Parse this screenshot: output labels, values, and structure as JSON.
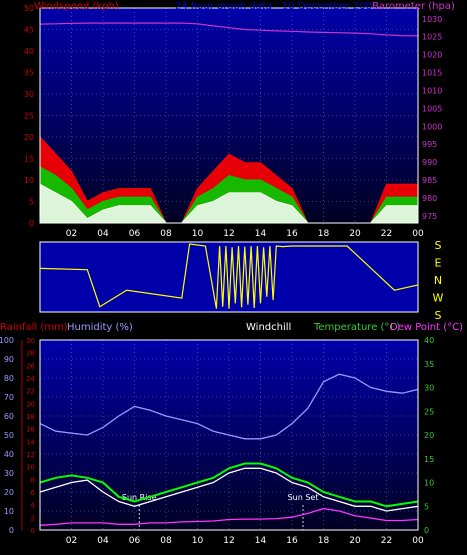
{
  "header": {
    "left_label": "Windspeed (kph)",
    "center_label": "24 hour graph data - 10 December 2008",
    "right_label": "Barometer (hpa)"
  },
  "colors": {
    "background": "#000000",
    "plot_top": "#0000aa",
    "plot_bottom": "#000022",
    "grid": "#6b6bd6",
    "wind_gust": "#ff0000",
    "wind_avg": "#00cc00",
    "wind_speed": "#ffffff",
    "barometer": "#cc33cc",
    "direction_plot": "#0000aa",
    "direction_line": "#ffff00",
    "rain_label": "#cc0000",
    "humidity": "#9999ff",
    "windchill_label": "#ffffff",
    "temperature": "#00ff00",
    "dewpoint": "#ff33ff",
    "wind_axis": "#cc0000",
    "baro_axis": "#cc33cc",
    "temp_axis": "#33cc33",
    "sun_marker": "#ffffff"
  },
  "chart_data": [
    {
      "type": "line",
      "xlabel": "",
      "x_ticks": [
        "02",
        "04",
        "06",
        "08",
        "10",
        "12",
        "14",
        "16",
        "18",
        "20",
        "22",
        "00"
      ],
      "left_axis": {
        "label": "Windspeed (kph)",
        "ticks": [
          0,
          5,
          10,
          15,
          20,
          25,
          30,
          35,
          40,
          45,
          50
        ],
        "ylim": [
          0,
          50
        ]
      },
      "right_axis": {
        "label": "Barometer (hpa)",
        "ticks": [
          975,
          980,
          985,
          990,
          995,
          1000,
          1005,
          1010,
          1015,
          1020,
          1025,
          1030
        ],
        "ylim": [
          973,
          1033
        ]
      },
      "hours": [
        0,
        1,
        2,
        3,
        4,
        5,
        6,
        7,
        8,
        9,
        10,
        11,
        12,
        13,
        14,
        15,
        16,
        17,
        18,
        19,
        20,
        21,
        22,
        23,
        24
      ],
      "series": [
        {
          "axis": "left",
          "values": [
            20,
            16,
            12,
            5,
            7,
            8,
            8,
            8,
            0,
            0,
            8,
            12,
            16,
            14,
            14,
            11,
            8,
            0,
            0,
            0,
            0,
            0,
            9,
            9,
            9
          ]
        },
        {
          "axis": "left",
          "values": [
            13,
            11,
            8,
            3,
            5,
            6,
            6,
            6,
            0,
            0,
            6,
            8,
            11,
            10,
            10,
            8,
            6,
            0,
            0,
            0,
            0,
            0,
            6,
            6,
            6
          ]
        },
        {
          "axis": "left",
          "values": [
            9,
            7,
            5,
            1,
            3,
            4,
            4,
            4,
            0,
            0,
            4,
            5,
            7,
            7,
            7,
            5,
            4,
            0,
            0,
            0,
            0,
            0,
            4,
            4,
            4
          ]
        },
        {
          "axis": "right",
          "values": [
            1028.5,
            1028.6,
            1028.7,
            1028.8,
            1028.8,
            1028.8,
            1028.8,
            1028.8,
            1028.8,
            1028.8,
            1028.6,
            1028.0,
            1027.5,
            1027.0,
            1026.8,
            1026.6,
            1026.5,
            1026.3,
            1026.2,
            1026.1,
            1026.0,
            1025.8,
            1025.5,
            1025.3,
            1025.2
          ]
        }
      ]
    },
    {
      "type": "line",
      "xlabel": "",
      "direction_labels": [
        "S",
        "E",
        "N",
        "W",
        "S"
      ],
      "hours": [
        0,
        3,
        3.8,
        5.5,
        9,
        9.5,
        10.5,
        11.2,
        11.4,
        11.6,
        11.8,
        12.0,
        12.2,
        12.4,
        12.6,
        12.8,
        13.0,
        13.2,
        13.4,
        13.6,
        13.8,
        14.0,
        14.2,
        14.4,
        14.6,
        14.8,
        15.0,
        15.4,
        16.0,
        19.5,
        22.5,
        24
      ],
      "values": [
        0.63,
        0.61,
        0.05,
        0.3,
        0.18,
        1.0,
        0.97,
        0.02,
        0.97,
        0.05,
        0.97,
        0.02,
        0.95,
        0.1,
        0.97,
        0.04,
        0.96,
        0.08,
        0.97,
        0.03,
        0.97,
        0.1,
        0.95,
        0.2,
        0.97,
        0.15,
        0.97,
        0.96,
        0.97,
        0.97,
        0.3,
        0.38
      ]
    },
    {
      "type": "line",
      "x_ticks": [
        "02",
        "04",
        "06",
        "08",
        "10",
        "12",
        "14",
        "16",
        "18",
        "20",
        "22",
        "00"
      ],
      "left_axis_humidity": {
        "label": "Humidity (%)",
        "ticks": [
          0,
          10,
          20,
          30,
          40,
          50,
          60,
          70,
          80,
          90,
          100
        ],
        "ylim": [
          0,
          100
        ]
      },
      "left_axis_rain": {
        "label": "Rainfall (mm)",
        "ticks": [
          0,
          2,
          4,
          6,
          8,
          10,
          12,
          14,
          16,
          18,
          20,
          22,
          24,
          26,
          28,
          30
        ],
        "ylim": [
          0,
          30
        ]
      },
      "right_axis": {
        "label": "Temperature (°C)",
        "ticks": [
          0,
          5,
          10,
          15,
          20,
          25,
          30,
          35,
          40
        ],
        "ylim": [
          0,
          40
        ]
      },
      "extra_labels": [
        "Windchill",
        "Dew Point (°C)"
      ],
      "sun_rise_hour": 6.3,
      "sun_set_hour": 16.7,
      "sun_rise_label": "Sun Rise",
      "sun_set_label": "Sun Set",
      "hours": [
        0,
        1,
        2,
        3,
        4,
        5,
        6,
        7,
        8,
        9,
        10,
        11,
        12,
        13,
        14,
        15,
        16,
        17,
        18,
        19,
        20,
        21,
        22,
        23,
        24
      ],
      "series": [
        {
          "name": "Humidity (%)",
          "axis": "humidity",
          "values": [
            56,
            52,
            51,
            50,
            54,
            60,
            65,
            63,
            60,
            58,
            56,
            52,
            50,
            48,
            48,
            50,
            56,
            64,
            78,
            82,
            80,
            75,
            73,
            72,
            74
          ]
        },
        {
          "name": "Temperature (°C)",
          "axis": "temp",
          "values": [
            10,
            11,
            11.5,
            11,
            10,
            7,
            6,
            7,
            8,
            9,
            10,
            11,
            13,
            14,
            14,
            13,
            11,
            10,
            8,
            7,
            6,
            6,
            5,
            5.5,
            6
          ]
        },
        {
          "name": "Windchill",
          "axis": "temp",
          "values": [
            8,
            9,
            10,
            10.5,
            8,
            6,
            5,
            6,
            7,
            8,
            9,
            10,
            12,
            13,
            13,
            12,
            10,
            9,
            7,
            6,
            5,
            5,
            4,
            4.5,
            5
          ]
        },
        {
          "name": "Dew Point (°C)",
          "axis": "temp",
          "values": [
            1,
            1.2,
            1.5,
            1.5,
            1.5,
            1.2,
            1.2,
            1.5,
            1.5,
            1.7,
            1.8,
            1.9,
            2.2,
            2.3,
            2.3,
            2.4,
            2.7,
            3.5,
            4.5,
            4.0,
            3.0,
            2.5,
            2.0,
            2.0,
            2.2
          ]
        }
      ]
    }
  ]
}
